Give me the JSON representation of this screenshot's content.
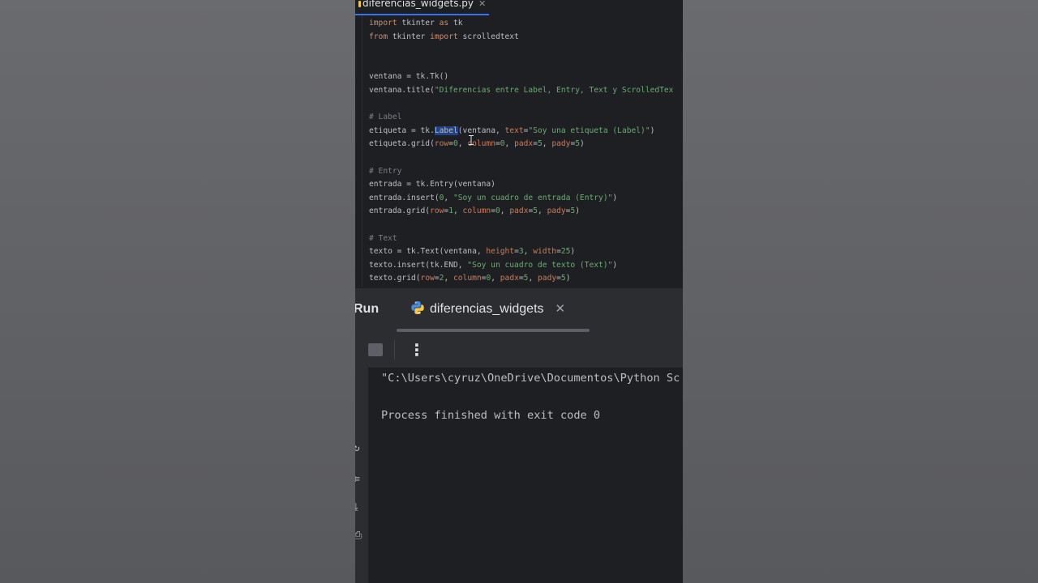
{
  "editor": {
    "tab": {
      "filename": "diferencias_widgets.py",
      "close": "✕"
    },
    "code_lines": [
      [
        {
          "t": "import",
          "c": "kw"
        },
        {
          "t": " tkinter "
        },
        {
          "t": "as",
          "c": "kw"
        },
        {
          "t": " tk"
        }
      ],
      [
        {
          "t": "from",
          "c": "kw"
        },
        {
          "t": " tkinter "
        },
        {
          "t": "import",
          "c": "kw"
        },
        {
          "t": " scrolledtext"
        }
      ],
      [],
      [],
      [
        {
          "t": "ventana = tk.Tk()"
        }
      ],
      [
        {
          "t": "ventana.title("
        },
        {
          "t": "\"Diferencias entre Label, Entry, Text y ScrolledTex",
          "c": "str"
        }
      ],
      [],
      [
        {
          "t": "# Label",
          "c": "cmt"
        }
      ],
      [
        {
          "t": "etiqueta = tk."
        },
        {
          "t": "Label",
          "c": "hl-sel"
        },
        {
          "t": "(ventana, "
        },
        {
          "t": "text",
          "c": "param"
        },
        {
          "t": "="
        },
        {
          "t": "\"Soy una etiqueta (Label)\"",
          "c": "str"
        },
        {
          "t": ")"
        }
      ],
      [
        {
          "t": "etiqueta.grid("
        },
        {
          "t": "row",
          "c": "param"
        },
        {
          "t": "="
        },
        {
          "t": "0",
          "c": "str"
        },
        {
          "t": ", "
        },
        {
          "t": "column",
          "c": "param"
        },
        {
          "t": "="
        },
        {
          "t": "0",
          "c": "str"
        },
        {
          "t": ", "
        },
        {
          "t": "padx",
          "c": "param"
        },
        {
          "t": "="
        },
        {
          "t": "5",
          "c": "str"
        },
        {
          "t": ", "
        },
        {
          "t": "pady",
          "c": "param"
        },
        {
          "t": "="
        },
        {
          "t": "5",
          "c": "str"
        },
        {
          "t": ")"
        }
      ],
      [],
      [
        {
          "t": "# Entry",
          "c": "cmt"
        }
      ],
      [
        {
          "t": "entrada = tk.Entry(ventana)"
        }
      ],
      [
        {
          "t": "entrada.insert("
        },
        {
          "t": "0",
          "c": "str"
        },
        {
          "t": ", "
        },
        {
          "t": "\"Soy un cuadro de entrada (Entry)\"",
          "c": "str"
        },
        {
          "t": ")"
        }
      ],
      [
        {
          "t": "entrada.grid("
        },
        {
          "t": "row",
          "c": "param"
        },
        {
          "t": "="
        },
        {
          "t": "1",
          "c": "str"
        },
        {
          "t": ", "
        },
        {
          "t": "column",
          "c": "param"
        },
        {
          "t": "="
        },
        {
          "t": "0",
          "c": "str"
        },
        {
          "t": ", "
        },
        {
          "t": "padx",
          "c": "param"
        },
        {
          "t": "="
        },
        {
          "t": "5",
          "c": "str"
        },
        {
          "t": ", "
        },
        {
          "t": "pady",
          "c": "param"
        },
        {
          "t": "="
        },
        {
          "t": "5",
          "c": "str"
        },
        {
          "t": ")"
        }
      ],
      [],
      [
        {
          "t": "# Text",
          "c": "cmt"
        }
      ],
      [
        {
          "t": "texto = tk.Text(ventana, "
        },
        {
          "t": "height",
          "c": "param"
        },
        {
          "t": "="
        },
        {
          "t": "3",
          "c": "str"
        },
        {
          "t": ", "
        },
        {
          "t": "width",
          "c": "param"
        },
        {
          "t": "="
        },
        {
          "t": "25",
          "c": "str"
        },
        {
          "t": ")"
        }
      ],
      [
        {
          "t": "texto.insert(tk.END, "
        },
        {
          "t": "\"Soy un cuadro de texto (Text)\"",
          "c": "str"
        },
        {
          "t": ")"
        }
      ],
      [
        {
          "t": "texto.grid("
        },
        {
          "t": "row",
          "c": "param"
        },
        {
          "t": "="
        },
        {
          "t": "2",
          "c": "str"
        },
        {
          "t": ", "
        },
        {
          "t": "column",
          "c": "param"
        },
        {
          "t": "="
        },
        {
          "t": "0",
          "c": "str"
        },
        {
          "t": ", "
        },
        {
          "t": "padx",
          "c": "param"
        },
        {
          "t": "="
        },
        {
          "t": "5",
          "c": "str"
        },
        {
          "t": ", "
        },
        {
          "t": "pady",
          "c": "param"
        },
        {
          "t": "="
        },
        {
          "t": "5",
          "c": "str"
        },
        {
          "t": ")"
        }
      ]
    ]
  },
  "run_panel": {
    "title": "Run",
    "tab_label": "diferencias_widgets",
    "tab_close": "✕",
    "menu_glyph": "⋮"
  },
  "console": {
    "lines": [
      "\"C:\\Users\\cyruz\\OneDrive\\Documentos\\Python Sc",
      "",
      "Process finished with exit code 0"
    ]
  },
  "colors": {
    "accent": "#3574f0",
    "keyword": "#cf8e6d",
    "string": "#6aab73",
    "comment": "#7a7e85",
    "param": "#c77d5e",
    "selection": "#214283"
  },
  "icons": [
    "python-icon",
    "stop-icon",
    "more-vertical-icon",
    "close-icon",
    "text-cursor-icon"
  ]
}
